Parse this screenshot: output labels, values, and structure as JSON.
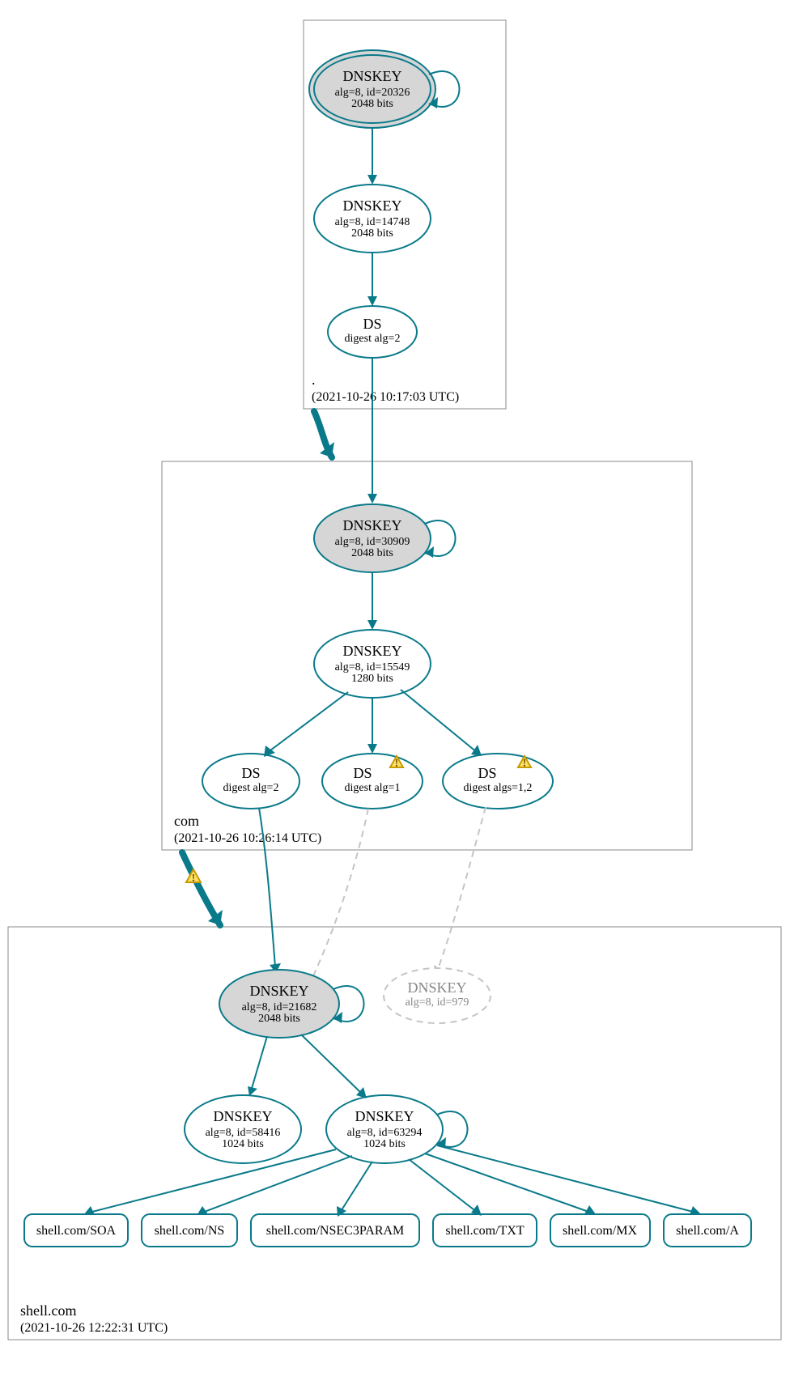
{
  "zones": {
    "root": {
      "name": ".",
      "timestamp": "(2021-10-26 10:17:03 UTC)",
      "dnskey_ksk": {
        "title": "DNSKEY",
        "line1": "alg=8, id=20326",
        "line2": "2048 bits"
      },
      "dnskey_zsk": {
        "title": "DNSKEY",
        "line1": "alg=8, id=14748",
        "line2": "2048 bits"
      },
      "ds": {
        "title": "DS",
        "line1": "digest alg=2"
      }
    },
    "com": {
      "name": "com",
      "timestamp": "(2021-10-26 10:26:14 UTC)",
      "dnskey_ksk": {
        "title": "DNSKEY",
        "line1": "alg=8, id=30909",
        "line2": "2048 bits"
      },
      "dnskey_zsk": {
        "title": "DNSKEY",
        "line1": "alg=8, id=15549",
        "line2": "1280 bits"
      },
      "ds1": {
        "title": "DS",
        "line1": "digest alg=2"
      },
      "ds2": {
        "title": "DS",
        "line1": "digest alg=1"
      },
      "ds3": {
        "title": "DS",
        "line1": "digest algs=1,2"
      }
    },
    "shell": {
      "name": "shell.com",
      "timestamp": "(2021-10-26 12:22:31 UTC)",
      "dnskey_ksk": {
        "title": "DNSKEY",
        "line1": "alg=8, id=21682",
        "line2": "2048 bits"
      },
      "dnskey_ghost": {
        "title": "DNSKEY",
        "line1": "alg=8, id=979"
      },
      "dnskey_58416": {
        "title": "DNSKEY",
        "line1": "alg=8, id=58416",
        "line2": "1024 bits"
      },
      "dnskey_63294": {
        "title": "DNSKEY",
        "line1": "alg=8, id=63294",
        "line2": "1024 bits"
      },
      "rr": {
        "soa": "shell.com/SOA",
        "ns": "shell.com/NS",
        "nsec3param": "shell.com/NSEC3PARAM",
        "txt": "shell.com/TXT",
        "mx": "shell.com/MX",
        "a": "shell.com/A"
      }
    }
  }
}
